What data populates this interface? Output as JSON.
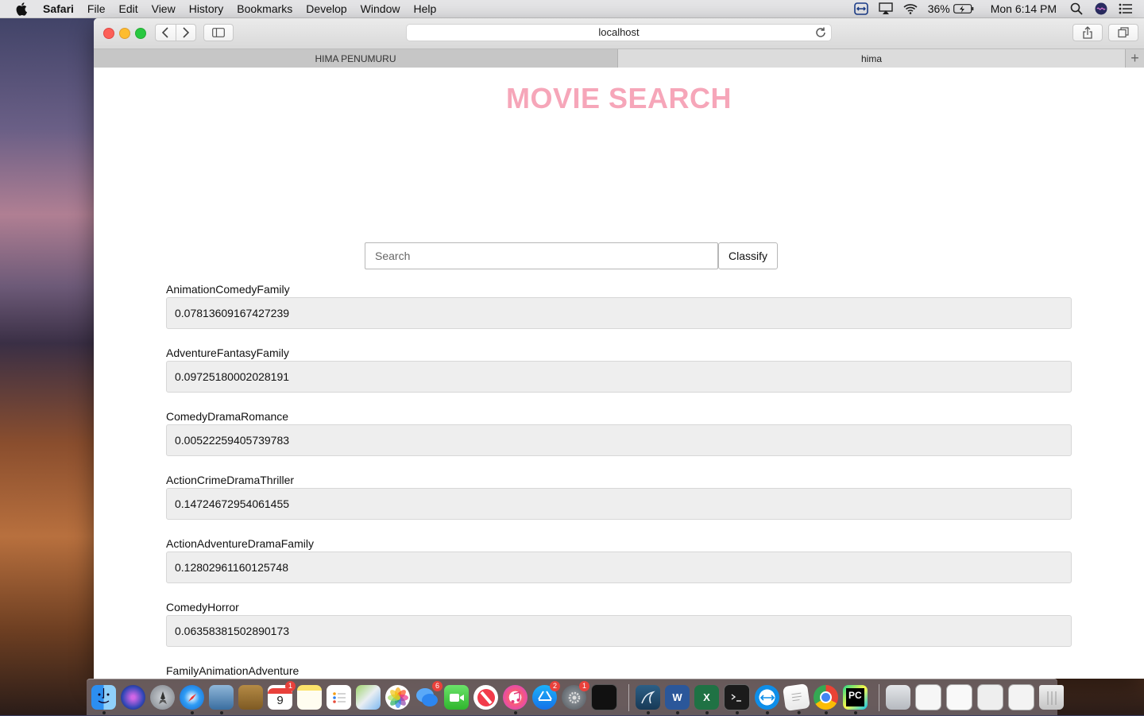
{
  "menubar": {
    "items": [
      "Safari",
      "File",
      "Edit",
      "View",
      "History",
      "Bookmarks",
      "Develop",
      "Window",
      "Help"
    ],
    "battery": "36%",
    "clock": "Mon 6:14 PM"
  },
  "browser": {
    "address": "localhost",
    "tabs": [
      "HIMA PENUMURU",
      "hima"
    ],
    "newtab": "+"
  },
  "page": {
    "title": "MOVIE SEARCH",
    "search": {
      "placeholder": "Search",
      "value": ""
    },
    "classify_label": "Classify",
    "results": [
      {
        "genre": "AnimationComedyFamily",
        "score": "0.07813609167427239"
      },
      {
        "genre": "AdventureFantasyFamily",
        "score": "0.09725180002028191"
      },
      {
        "genre": "ComedyDramaRomance",
        "score": "0.00522259405739783"
      },
      {
        "genre": "ActionCrimeDramaThriller",
        "score": "0.14724672954061455"
      },
      {
        "genre": "ActionAdventureDramaFamily",
        "score": "0.12802961160125748"
      },
      {
        "genre": "ComedyHorror",
        "score": "0.06358381502890173"
      },
      {
        "genre": "FamilyAnimationAdventure",
        "score": ""
      }
    ]
  },
  "dock": {
    "calendar_day": "9",
    "badges": {
      "calendar": "1",
      "messages": "6",
      "appstore": "2",
      "preferences": "1"
    },
    "excel_letter": "X",
    "word_letter": "W",
    "pycharm_letter": "PC"
  }
}
